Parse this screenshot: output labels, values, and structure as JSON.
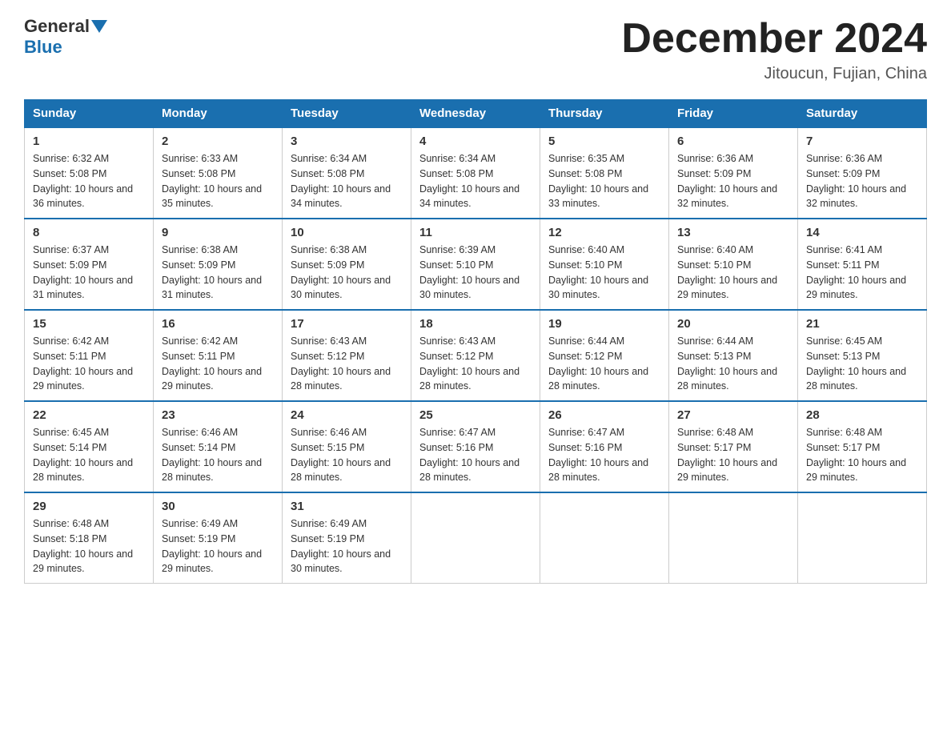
{
  "logo": {
    "general": "General",
    "blue": "Blue"
  },
  "title": "December 2024",
  "location": "Jitoucun, Fujian, China",
  "days_of_week": [
    "Sunday",
    "Monday",
    "Tuesday",
    "Wednesday",
    "Thursday",
    "Friday",
    "Saturday"
  ],
  "weeks": [
    [
      {
        "day": "1",
        "sunrise": "6:32 AM",
        "sunset": "5:08 PM",
        "daylight": "10 hours and 36 minutes."
      },
      {
        "day": "2",
        "sunrise": "6:33 AM",
        "sunset": "5:08 PM",
        "daylight": "10 hours and 35 minutes."
      },
      {
        "day": "3",
        "sunrise": "6:34 AM",
        "sunset": "5:08 PM",
        "daylight": "10 hours and 34 minutes."
      },
      {
        "day": "4",
        "sunrise": "6:34 AM",
        "sunset": "5:08 PM",
        "daylight": "10 hours and 34 minutes."
      },
      {
        "day": "5",
        "sunrise": "6:35 AM",
        "sunset": "5:08 PM",
        "daylight": "10 hours and 33 minutes."
      },
      {
        "day": "6",
        "sunrise": "6:36 AM",
        "sunset": "5:09 PM",
        "daylight": "10 hours and 32 minutes."
      },
      {
        "day": "7",
        "sunrise": "6:36 AM",
        "sunset": "5:09 PM",
        "daylight": "10 hours and 32 minutes."
      }
    ],
    [
      {
        "day": "8",
        "sunrise": "6:37 AM",
        "sunset": "5:09 PM",
        "daylight": "10 hours and 31 minutes."
      },
      {
        "day": "9",
        "sunrise": "6:38 AM",
        "sunset": "5:09 PM",
        "daylight": "10 hours and 31 minutes."
      },
      {
        "day": "10",
        "sunrise": "6:38 AM",
        "sunset": "5:09 PM",
        "daylight": "10 hours and 30 minutes."
      },
      {
        "day": "11",
        "sunrise": "6:39 AM",
        "sunset": "5:10 PM",
        "daylight": "10 hours and 30 minutes."
      },
      {
        "day": "12",
        "sunrise": "6:40 AM",
        "sunset": "5:10 PM",
        "daylight": "10 hours and 30 minutes."
      },
      {
        "day": "13",
        "sunrise": "6:40 AM",
        "sunset": "5:10 PM",
        "daylight": "10 hours and 29 minutes."
      },
      {
        "day": "14",
        "sunrise": "6:41 AM",
        "sunset": "5:11 PM",
        "daylight": "10 hours and 29 minutes."
      }
    ],
    [
      {
        "day": "15",
        "sunrise": "6:42 AM",
        "sunset": "5:11 PM",
        "daylight": "10 hours and 29 minutes."
      },
      {
        "day": "16",
        "sunrise": "6:42 AM",
        "sunset": "5:11 PM",
        "daylight": "10 hours and 29 minutes."
      },
      {
        "day": "17",
        "sunrise": "6:43 AM",
        "sunset": "5:12 PM",
        "daylight": "10 hours and 28 minutes."
      },
      {
        "day": "18",
        "sunrise": "6:43 AM",
        "sunset": "5:12 PM",
        "daylight": "10 hours and 28 minutes."
      },
      {
        "day": "19",
        "sunrise": "6:44 AM",
        "sunset": "5:12 PM",
        "daylight": "10 hours and 28 minutes."
      },
      {
        "day": "20",
        "sunrise": "6:44 AM",
        "sunset": "5:13 PM",
        "daylight": "10 hours and 28 minutes."
      },
      {
        "day": "21",
        "sunrise": "6:45 AM",
        "sunset": "5:13 PM",
        "daylight": "10 hours and 28 minutes."
      }
    ],
    [
      {
        "day": "22",
        "sunrise": "6:45 AM",
        "sunset": "5:14 PM",
        "daylight": "10 hours and 28 minutes."
      },
      {
        "day": "23",
        "sunrise": "6:46 AM",
        "sunset": "5:14 PM",
        "daylight": "10 hours and 28 minutes."
      },
      {
        "day": "24",
        "sunrise": "6:46 AM",
        "sunset": "5:15 PM",
        "daylight": "10 hours and 28 minutes."
      },
      {
        "day": "25",
        "sunrise": "6:47 AM",
        "sunset": "5:16 PM",
        "daylight": "10 hours and 28 minutes."
      },
      {
        "day": "26",
        "sunrise": "6:47 AM",
        "sunset": "5:16 PM",
        "daylight": "10 hours and 28 minutes."
      },
      {
        "day": "27",
        "sunrise": "6:48 AM",
        "sunset": "5:17 PM",
        "daylight": "10 hours and 29 minutes."
      },
      {
        "day": "28",
        "sunrise": "6:48 AM",
        "sunset": "5:17 PM",
        "daylight": "10 hours and 29 minutes."
      }
    ],
    [
      {
        "day": "29",
        "sunrise": "6:48 AM",
        "sunset": "5:18 PM",
        "daylight": "10 hours and 29 minutes."
      },
      {
        "day": "30",
        "sunrise": "6:49 AM",
        "sunset": "5:19 PM",
        "daylight": "10 hours and 29 minutes."
      },
      {
        "day": "31",
        "sunrise": "6:49 AM",
        "sunset": "5:19 PM",
        "daylight": "10 hours and 30 minutes."
      },
      null,
      null,
      null,
      null
    ]
  ]
}
